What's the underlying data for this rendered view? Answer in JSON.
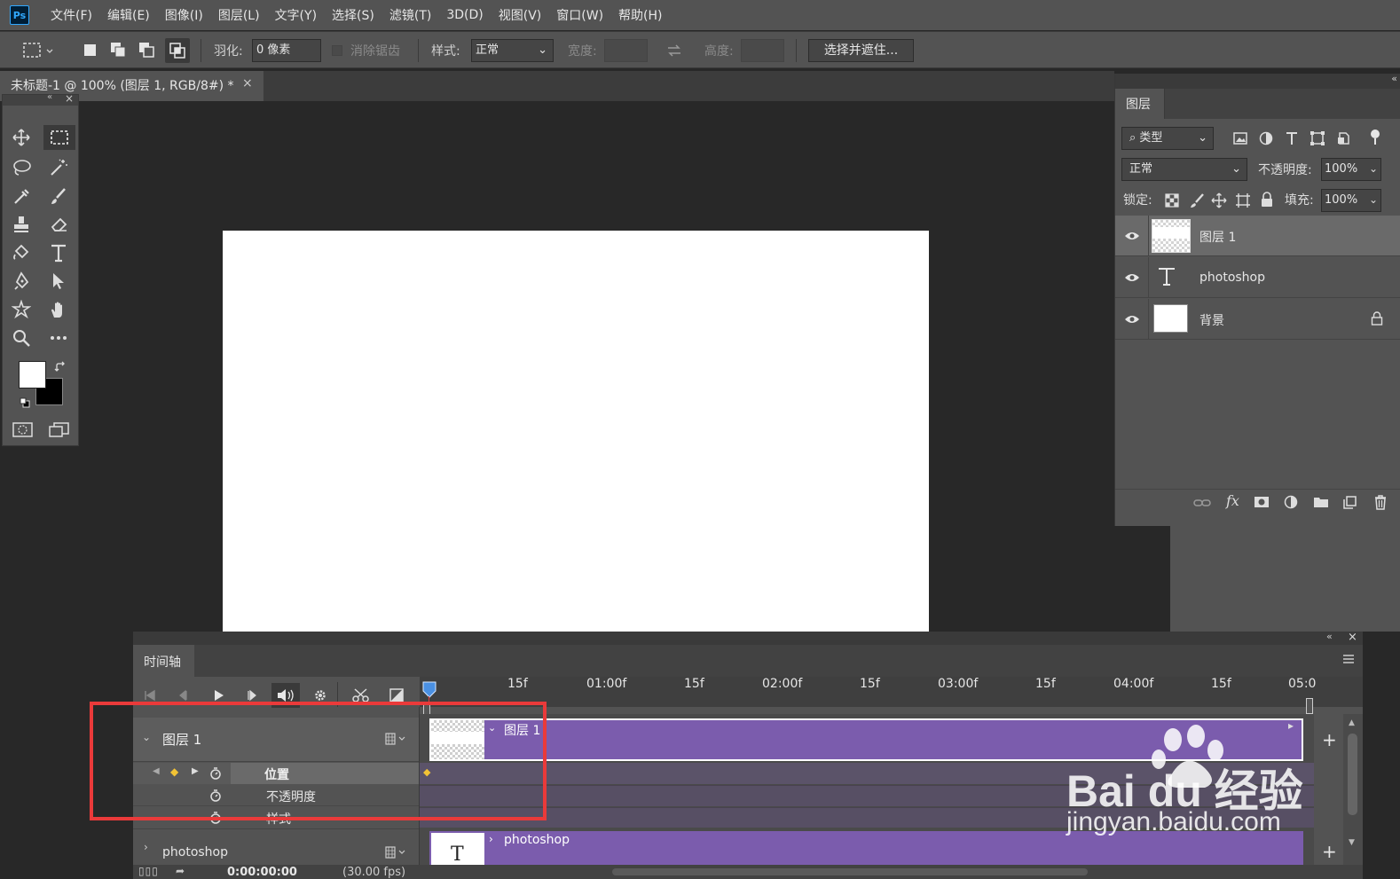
{
  "app": {
    "logo": "Ps"
  },
  "menu": [
    "文件(F)",
    "编辑(E)",
    "图像(I)",
    "图层(L)",
    "文字(Y)",
    "选择(S)",
    "滤镜(T)",
    "3D(D)",
    "视图(V)",
    "窗口(W)",
    "帮助(H)"
  ],
  "options": {
    "feather_label": "羽化:",
    "feather_value": "0 像素",
    "antialias_label": "消除锯齿",
    "style_label": "样式:",
    "style_value": "正常",
    "width_label": "宽度:",
    "height_label": "高度:",
    "select_mask_button": "选择并遮住..."
  },
  "document": {
    "tab_title": "未标题-1 @ 100% (图层 1, RGB/8#) *",
    "close": "×"
  },
  "layers_panel": {
    "tab": "图层",
    "filter_value": "类型",
    "blend_mode": "正常",
    "opacity_label": "不透明度:",
    "opacity_value": "100%",
    "lock_label": "锁定:",
    "fill_label": "填充:",
    "fill_value": "100%",
    "layers": [
      {
        "name": "图层 1",
        "thumb": "transparent",
        "selected": true
      },
      {
        "name": "photoshop",
        "thumb": "text",
        "selected": false
      },
      {
        "name": "背景",
        "thumb": "white",
        "selected": false,
        "locked": true
      }
    ]
  },
  "timeline": {
    "tab": "时间轴",
    "ruler": [
      "15f",
      "01:00f",
      "15f",
      "02:00f",
      "15f",
      "03:00f",
      "15f",
      "04:00f",
      "15f",
      "05:0"
    ],
    "layer1": {
      "name": "图层 1",
      "clip_label": "图层 1"
    },
    "properties": [
      "位置",
      "不透明度",
      "样式"
    ],
    "layer2": {
      "name": "photoshop",
      "clip_label": "photoshop"
    },
    "timecode": "0:00:00:00",
    "fps": "(30.00 fps)"
  },
  "watermark": {
    "brand": "Bai du 经验",
    "url": "jingyan.baidu.com"
  },
  "colors": {
    "accent": "#31a8ff",
    "clip": "#7b5cad",
    "highlight": "#ea3a3a",
    "keyframe": "#f2c335"
  }
}
